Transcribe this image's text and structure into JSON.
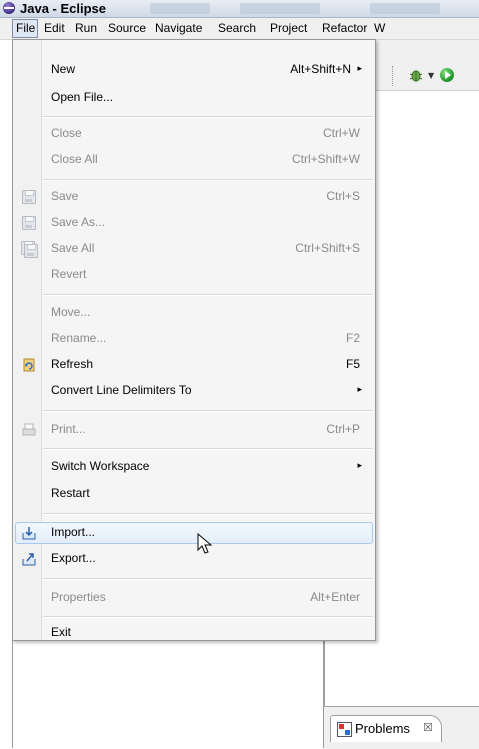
{
  "window": {
    "title": "Java - Eclipse"
  },
  "menubar": {
    "items": [
      "File",
      "Edit",
      "Run",
      "Source",
      "Navigate",
      "Search",
      "Project",
      "Refactor",
      "W"
    ],
    "active": "File"
  },
  "file_menu": {
    "new": {
      "label": "New",
      "shortcut": "Alt+Shift+N"
    },
    "open_file": {
      "label": "Open File..."
    },
    "close": {
      "label": "Close",
      "shortcut": "Ctrl+W"
    },
    "close_all": {
      "label": "Close All",
      "shortcut": "Ctrl+Shift+W"
    },
    "save": {
      "label": "Save",
      "shortcut": "Ctrl+S"
    },
    "save_as": {
      "label": "Save As..."
    },
    "save_all": {
      "label": "Save All",
      "shortcut": "Ctrl+Shift+S"
    },
    "revert": {
      "label": "Revert"
    },
    "move": {
      "label": "Move..."
    },
    "rename": {
      "label": "Rename...",
      "shortcut": "F2"
    },
    "refresh": {
      "label": "Refresh",
      "shortcut": "F5"
    },
    "convert": {
      "label": "Convert Line Delimiters To"
    },
    "print": {
      "label": "Print...",
      "shortcut": "Ctrl+P"
    },
    "switch_workspace": {
      "label": "Switch Workspace"
    },
    "restart": {
      "label": "Restart"
    },
    "import": {
      "label": "Import..."
    },
    "export": {
      "label": "Export..."
    },
    "properties": {
      "label": "Properties",
      "shortcut": "Alt+Enter"
    },
    "exit": {
      "label": "Exit"
    }
  },
  "views": {
    "problems_tab": "Problems",
    "problems_close": "☒"
  },
  "icons": {
    "app": "eclipse-icon",
    "debug": "bug-icon",
    "run": "run-icon",
    "submenu": "▸"
  }
}
